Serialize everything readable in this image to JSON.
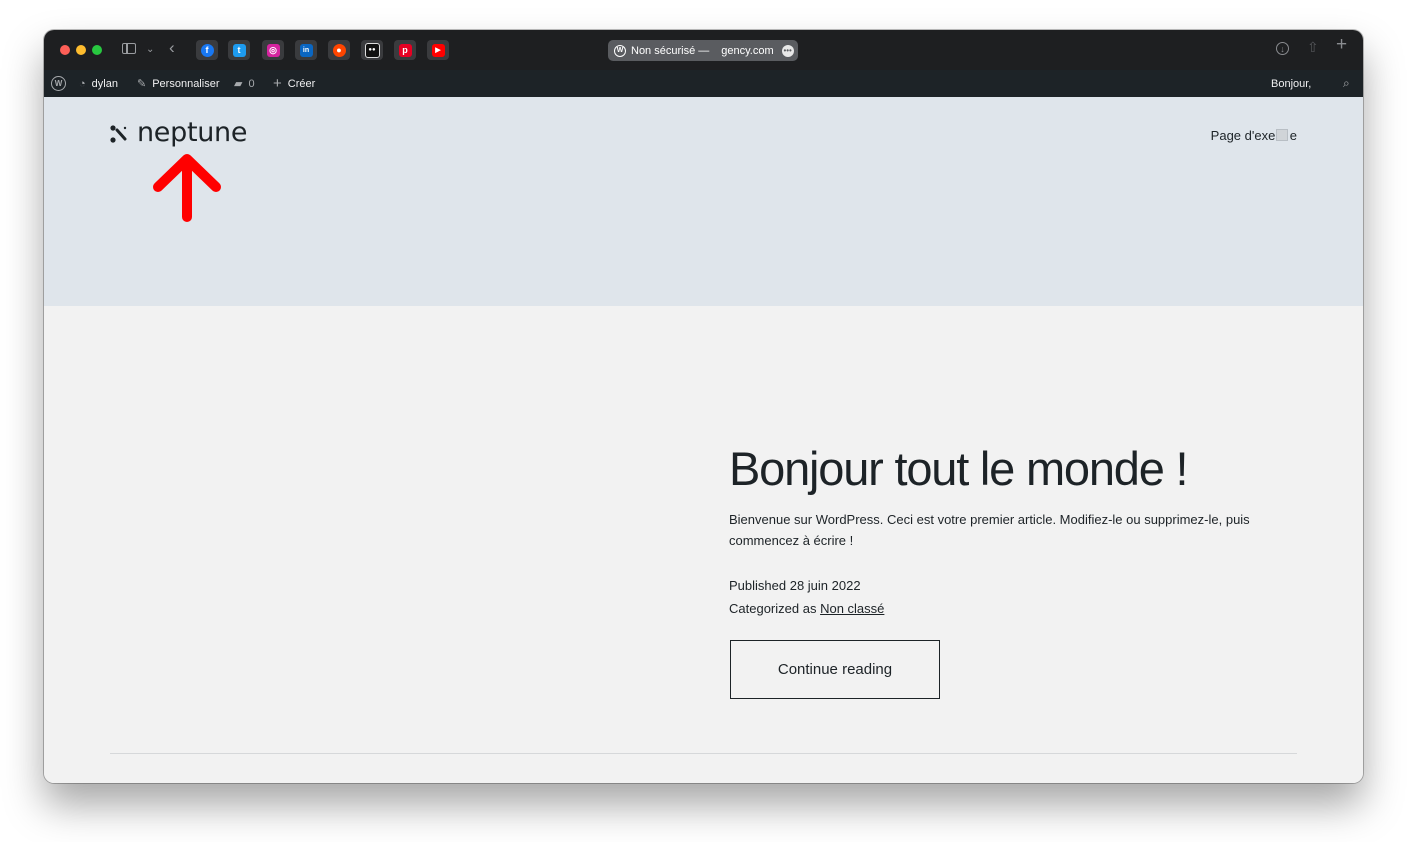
{
  "browser": {
    "address": {
      "security_label": "Non sécurisé —",
      "domain_hidden": "",
      "domain_visible": "gency.com"
    },
    "favorites": [
      {
        "name": "facebook",
        "color": "#1877f2",
        "glyph": "f"
      },
      {
        "name": "twitter",
        "color": "#1d9bf0",
        "glyph": "t"
      },
      {
        "name": "instagram",
        "color": "#d6249f",
        "glyph": "◎"
      },
      {
        "name": "linkedin",
        "color": "#0a66c2",
        "glyph": "in"
      },
      {
        "name": "reddit",
        "color": "#ff4500",
        "glyph": "●"
      },
      {
        "name": "medium",
        "color": "#111111",
        "glyph": "●●"
      },
      {
        "name": "pinterest",
        "color": "#e60023",
        "glyph": "p"
      },
      {
        "name": "youtube",
        "color": "#ff0000",
        "glyph": "▶"
      }
    ]
  },
  "adminbar": {
    "site_name": "dylan",
    "customize": "Personnaliser",
    "comments_count": "0",
    "new": "Créer",
    "greeting": "Bonjour,"
  },
  "header": {
    "logo_text": "neptune",
    "nav_link": "Page d'exem  e"
  },
  "post": {
    "title": "Bonjour tout le monde !",
    "excerpt": "Bienvenue sur WordPress. Ceci est votre premier article. Modifiez-le ou supprimez-le, puis commencez à écrire !",
    "published": "Published 28 juin 2022",
    "categorized_prefix": "Categorized as",
    "category": "Non classé",
    "continue_label": "Continue reading"
  },
  "colors": {
    "header_bg": "#dfe5eb",
    "main_bg": "#f2f2f2",
    "arrow": "#ff0000",
    "adminbar_bg": "#1d2327"
  }
}
